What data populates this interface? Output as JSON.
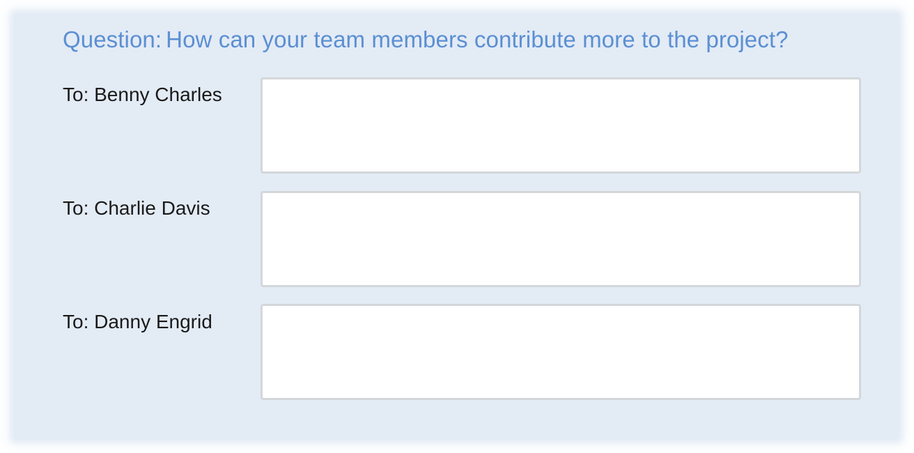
{
  "question": {
    "prefix": "Question:",
    "text": "How can your team members contribute more to the project?"
  },
  "recipients": [
    {
      "label": "To: Benny Charles",
      "value": ""
    },
    {
      "label": "To: Charlie Davis",
      "value": ""
    },
    {
      "label": "To: Danny Engrid",
      "value": ""
    }
  ],
  "colors": {
    "panel_background": "#e3ebf5",
    "question_text": "#5b8fd2",
    "box_border": "#d4d7da"
  }
}
